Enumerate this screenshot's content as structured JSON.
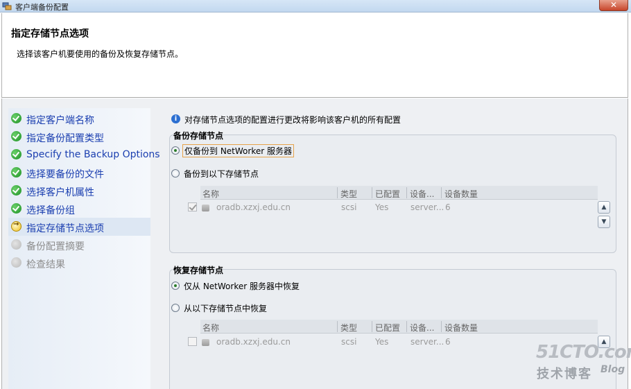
{
  "window": {
    "title": "客户端备份配置"
  },
  "header": {
    "title": "指定存储节点选项",
    "description": "选择该客户机要使用的备份及恢复存储节点。"
  },
  "sidebar": {
    "steps": [
      {
        "label": "指定客户端名称",
        "state": "done"
      },
      {
        "label": "指定备份配置类型",
        "state": "done"
      },
      {
        "label": "Specify the Backup Options",
        "state": "done"
      },
      {
        "label": "选择要备份的文件",
        "state": "done"
      },
      {
        "label": "选择客户机属性",
        "state": "done"
      },
      {
        "label": "选择备份组",
        "state": "done"
      },
      {
        "label": "指定存储节点选项",
        "state": "current"
      },
      {
        "label": "备份配置摘要",
        "state": "pending"
      },
      {
        "label": "检查结果",
        "state": "pending"
      }
    ]
  },
  "main": {
    "info_text": "对存储节点选项的配置进行更改将影响该客户机的所有配置",
    "columns": [
      "名称",
      "类型",
      "已配置",
      "设备...",
      "设备数量"
    ],
    "backup": {
      "title": "备份存储节点",
      "option_server_only": "仅备份到 NetWorker 服务器",
      "option_listed_nodes": "备份到以下存储节点",
      "selected": "server_only",
      "rows": [
        {
          "checked": true,
          "name": "oradb.xzxj.edu.cn",
          "type": "scsi",
          "configured": "Yes",
          "device": "server...",
          "count": "6"
        }
      ]
    },
    "restore": {
      "title": "恢复存储节点",
      "option_server_only": "仅从 NetWorker 服务器中恢复",
      "option_listed_nodes": "从以下存储节点中恢复",
      "selected": "server_only",
      "rows": [
        {
          "checked": false,
          "name": "oradb.xzxj.edu.cn",
          "type": "scsi",
          "configured": "Yes",
          "device": "server...",
          "count": "6"
        }
      ]
    }
  },
  "watermark": {
    "top": "51CTO.com",
    "bottom": "技术博客",
    "blog": "Blog"
  },
  "colors": {
    "nav_link": "#1b3fb0",
    "pending": "#8d8d8d",
    "active_step_bg": "#dde7f3"
  }
}
